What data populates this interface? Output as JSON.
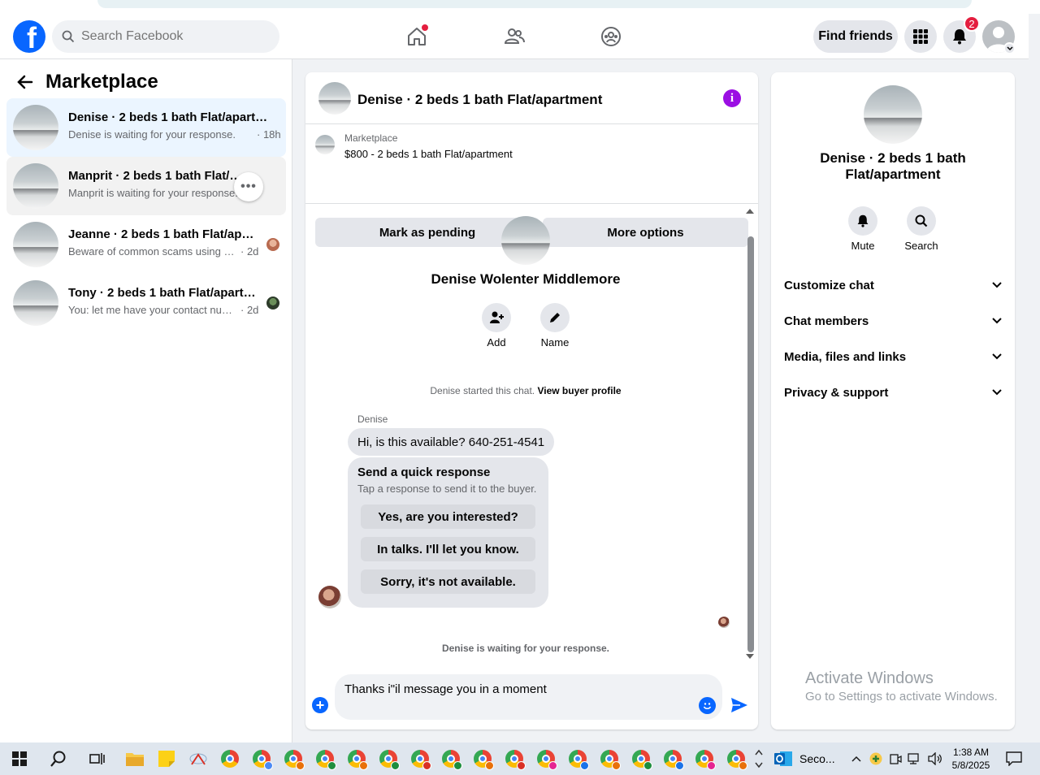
{
  "header": {
    "search_placeholder": "Search Facebook",
    "find_friends": "Find friends",
    "notification_count": "2"
  },
  "sidebar": {
    "title": "Marketplace",
    "conversations": [
      {
        "title": "Denise · 2 beds 1 bath Flat/apartm...",
        "subtitle": "Denise is waiting for your response.",
        "time": "· 18h"
      },
      {
        "title": "Manprit · 2 beds 1 bath Flat/ap...",
        "subtitle": "Manprit is waiting for your response.",
        "time": ""
      },
      {
        "title": "Jeanne · 2 beds 1 bath Flat/apar...",
        "subtitle": "Beware of common scams using p...",
        "time": "· 2d"
      },
      {
        "title": "Tony · 2 beds 1 bath Flat/apartm...",
        "subtitle": "You: let me have your contact num...",
        "time": "· 2d"
      }
    ]
  },
  "chat": {
    "header_title": "Denise · 2 beds 1 bath Flat/apartment",
    "listing_source": "Marketplace",
    "listing_price": "$800 - 2 beds 1 bath Flat/apartment",
    "mark_pending": "Mark as pending",
    "more_options": "More options",
    "buyer_name": "Denise Wolenter Middlemore",
    "add_label": "Add",
    "name_label": "Name",
    "started_note": "Denise started this chat.",
    "view_profile": "View buyer profile",
    "sender": "Denise",
    "message": "Hi, is this available?  640-251-4541",
    "quick_title": "Send a quick response",
    "quick_subtitle": "Tap a response to send it to the buyer.",
    "quick_replies": [
      "Yes, are you interested?",
      "In talks. I'll let you know.",
      "Sorry, it's not available."
    ],
    "waiting_note": "Denise is waiting for your response.",
    "composer_value": "Thanks i\"il message you in a moment"
  },
  "info": {
    "title": "Denise · 2 beds 1 bath Flat/apartment",
    "mute": "Mute",
    "search": "Search",
    "sections": [
      "Customize chat",
      "Chat members",
      "Media, files and links",
      "Privacy & support"
    ]
  },
  "watermark": {
    "line1": "Activate Windows",
    "line2": "Go to Settings to activate Windows."
  },
  "taskbar": {
    "outlook_label": "Seco...",
    "time": "1:38 AM",
    "date": "5/8/2025",
    "chrome_badge_colors": [
      "#4c8bf5",
      "#e8710a",
      "#1e8e3e",
      "#e8710a",
      "#1e8e3e",
      "#d93025",
      "#1e8e3e",
      "#e8710a",
      "#d93025",
      "#e52592",
      "#1a73e8",
      "#e8710a",
      "#1e8e3e",
      "#1a73e8",
      "#e52592",
      "#e8710a"
    ]
  },
  "colors": {
    "brand": "#0866ff",
    "info_purple": "#9b0fe3",
    "active_row": "#ebf5ff"
  }
}
